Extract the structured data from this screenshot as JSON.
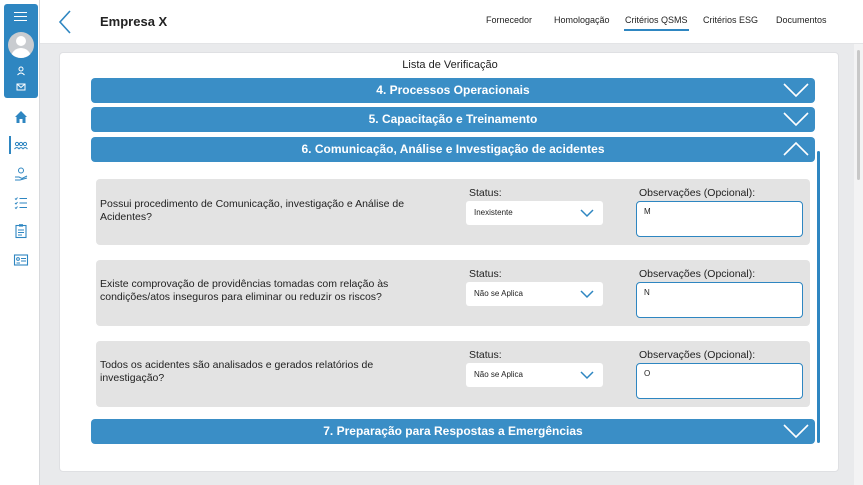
{
  "header": {
    "company": "Empresa X",
    "tabs": [
      {
        "label": "Fornecedor",
        "active": false
      },
      {
        "label": "Homologação",
        "active": false
      },
      {
        "label": "Critérios QSMS",
        "active": true
      },
      {
        "label": "Critérios ESG",
        "active": false
      },
      {
        "label": "Documentos",
        "active": false
      }
    ]
  },
  "sidebar": {
    "icons": [
      "menu-icon",
      "avatar",
      "user-icon",
      "mail-icon",
      "home-icon",
      "team-icon",
      "hand-coin-icon",
      "checklist-icon",
      "clipboard-icon",
      "id-card-icon"
    ],
    "accent": "#2e86c1"
  },
  "checklist": {
    "title": "Lista de Verificação",
    "sections": [
      {
        "label": "4. Processos Operacionais",
        "expanded": false
      },
      {
        "label": "5. Capacitação e Treinamento",
        "expanded": false
      },
      {
        "label": "6. Comunicação, Análise e Investigação de acidentes",
        "expanded": true
      },
      {
        "label": "7. Preparação para Respostas a Emergências",
        "expanded": false
      }
    ],
    "status_label": "Status:",
    "obs_label": "Observações (Opcional):",
    "questions": [
      {
        "text": "Possui procedimento de Comunicação, investigação e Análise de Acidentes?",
        "status": "Inexistente",
        "obs": "M"
      },
      {
        "text": "Existe comprovação de providências tomadas com relação às condições/atos inseguros para eliminar ou reduzir os riscos?",
        "status": "Não se Aplica",
        "obs": "N"
      },
      {
        "text": "Todos os acidentes são analisados e gerados relatórios de investigação?",
        "status": "Não se Aplica",
        "obs": "O"
      }
    ]
  },
  "colors": {
    "section_bg": "#3a8ec6",
    "accent": "#2e86c1"
  }
}
